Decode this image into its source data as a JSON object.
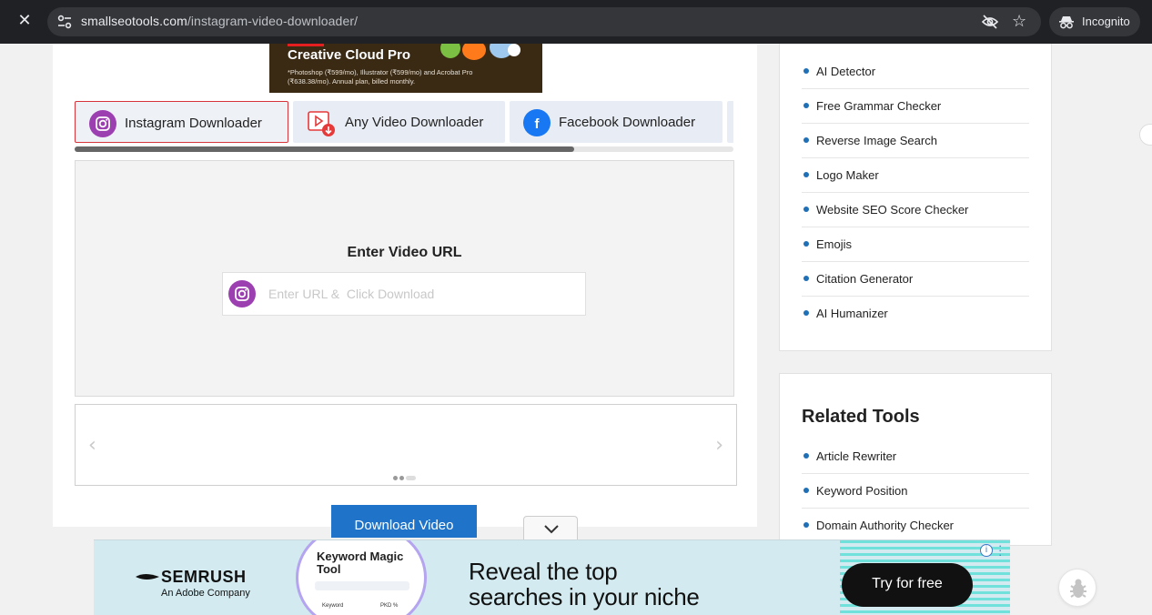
{
  "browser": {
    "url_domain": "smallseotools.com",
    "url_path": "/instagram-video-downloader/",
    "incognito_label": "Incognito"
  },
  "ad_top": {
    "title": "Creative Cloud Pro",
    "fine_print": "*Photoshop (₹599/mo), Illustrator (₹599/mo) and Acrobat Pro (₹638.38/mo). Annual plan, billed monthly."
  },
  "tabs": [
    {
      "label": "Instagram Downloader",
      "active": true,
      "color": "#9c3fb1"
    },
    {
      "label": "Any Video Downloader",
      "active": false,
      "color": "#e5393a"
    },
    {
      "label": "Facebook Downloader",
      "active": false,
      "color": "#1877f2"
    }
  ],
  "tool": {
    "title": "Enter Video URL",
    "placeholder": "Enter URL &  Click Download",
    "download_label": "Download Video"
  },
  "sidebar": {
    "items": [
      "AI Detector",
      "Free Grammar Checker",
      "Reverse Image Search",
      "Logo Maker",
      "Website SEO Score Checker",
      "Emojis",
      "Citation Generator",
      "AI Humanizer"
    ]
  },
  "related": {
    "title": "Related Tools",
    "items": [
      "Article Rewriter",
      "Keyword Position",
      "Domain Authority Checker"
    ]
  },
  "bottom_ad": {
    "brand": "SEMRUSH",
    "brand_sub": "An Adobe Company",
    "mock_title": "Keyword Magic Tool",
    "mock_label_1": "Keyword",
    "mock_label_2": "PKD %",
    "headline_1": "Reveal the top",
    "headline_2": "searches in your niche",
    "cta": "Try for free"
  },
  "colors": {
    "accent_blue": "#1f73c9",
    "instagram_purple": "#9c3fb1",
    "active_tab_border": "#d6343a"
  }
}
